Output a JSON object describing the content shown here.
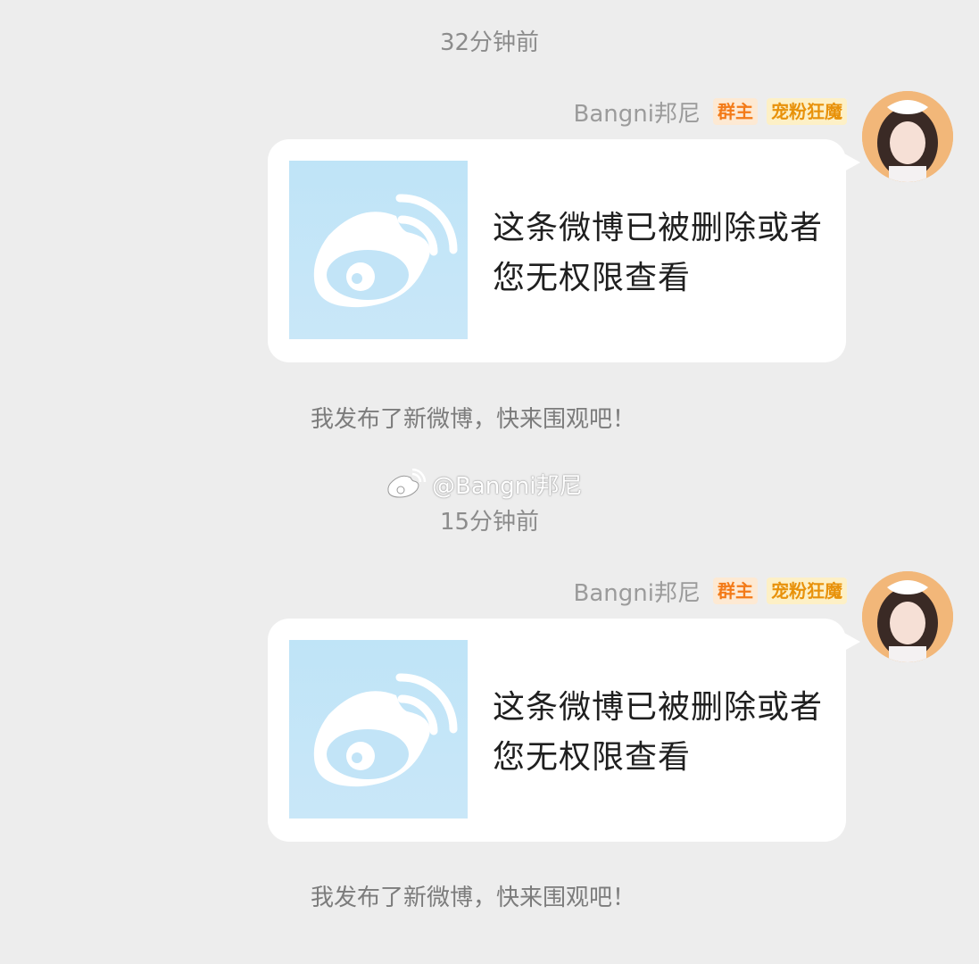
{
  "messages": [
    {
      "timestamp": "32分钟前",
      "sender": "Bangni邦尼",
      "badges": [
        "群主",
        "宠粉狂魔"
      ],
      "card_text": "这条微博已被删除或者您无权限查看",
      "caption": "我发布了新微博，快来围观吧！"
    },
    {
      "timestamp": "15分钟前",
      "sender": "Bangni邦尼",
      "badges": [
        "群主",
        "宠粉狂魔"
      ],
      "card_text": "这条微博已被删除或者您无权限查看",
      "caption": "我发布了新微博，快来围观吧！"
    }
  ],
  "watermark": "@Bangni邦尼",
  "colors": {
    "background": "#ededed",
    "owner_badge": "#f37a18",
    "fan_badge": "#e8920b",
    "thumb_blue": "#bfe4f7"
  }
}
